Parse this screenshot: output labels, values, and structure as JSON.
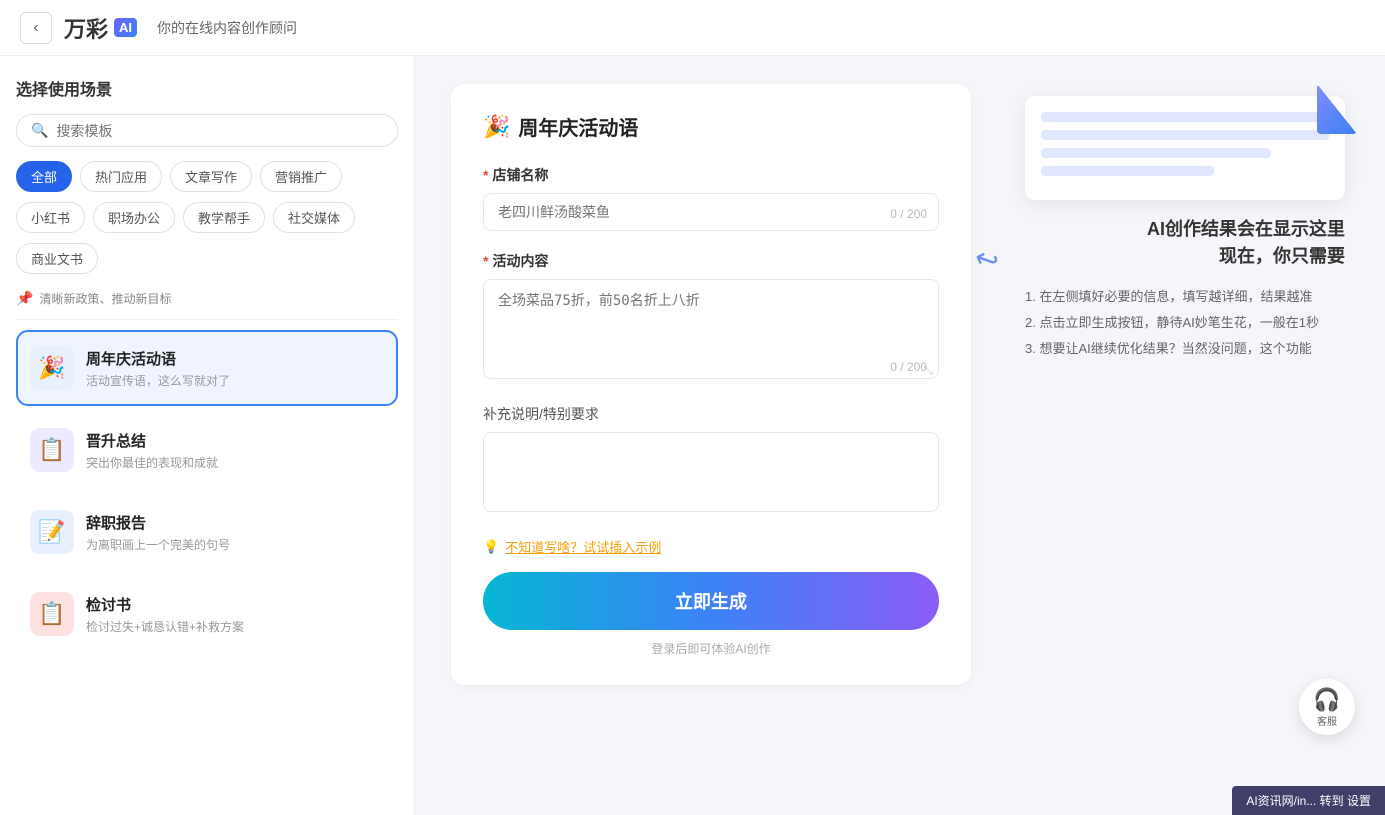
{
  "header": {
    "back_label": "‹",
    "logo_text": "万彩",
    "logo_ai": "AI",
    "subtitle": "你的在线内容创作顾问"
  },
  "sidebar": {
    "title": "选择使用场景",
    "search_placeholder": "搜索模板",
    "filter_tags": [
      {
        "label": "全部",
        "active": true
      },
      {
        "label": "热门应用",
        "active": false
      },
      {
        "label": "文章写作",
        "active": false
      },
      {
        "label": "营销推广",
        "active": false
      },
      {
        "label": "小红书",
        "active": false
      },
      {
        "label": "职场办公",
        "active": false
      },
      {
        "label": "教学帮手",
        "active": false
      },
      {
        "label": "社交媒体",
        "active": false
      },
      {
        "label": "商业文书",
        "active": false
      }
    ],
    "notice_text": "清晰新政策、推动新目标",
    "templates": [
      {
        "id": "anniversary",
        "icon": "🎉",
        "icon_class": "blue",
        "name": "周年庆活动语",
        "desc": "活动宣传语，这么写就对了",
        "active": true
      },
      {
        "id": "promotion",
        "icon": "📋",
        "icon_class": "purple",
        "name": "晋升总结",
        "desc": "突出你最佳的表现和成就",
        "active": false
      },
      {
        "id": "resignation",
        "icon": "📝",
        "icon_class": "blue",
        "name": "辞职报告",
        "desc": "为离职画上一个完美的句号",
        "active": false
      },
      {
        "id": "review",
        "icon": "📋",
        "icon_class": "red",
        "name": "检讨书",
        "desc": "检讨过失+诚恳认错+补救方案",
        "active": false
      }
    ]
  },
  "form": {
    "title": "周年庆活动语",
    "title_icon": "🎉",
    "fields": {
      "shop_name": {
        "label": "店铺名称",
        "required": true,
        "placeholder": "老四川鲜汤酸菜鱼",
        "char_count": "0 / 200"
      },
      "activity": {
        "label": "活动内容",
        "required": true,
        "placeholder": "全场菜品75折，前50名折上八折",
        "char_count": "0 / 200"
      },
      "supplement": {
        "label": "补充说明/特别要求",
        "required": false,
        "placeholder": ""
      }
    },
    "hint_text": "不知道写啥？试试插入示例",
    "hint_icon": "💡",
    "generate_btn": "立即生成",
    "login_hint": "登录后即可体验AI创作"
  },
  "illustration": {
    "caption_line1": "AI创作结果会在显示这里",
    "caption_line2": "现在，你只需要",
    "steps": [
      "1. 在左侧填好必要的信息，填写越详细，结果越准",
      "2. 点击立即生成按钮，静待AI妙笔生花，一般在1秒",
      "3. 想要让AI继续优化结果？当然没问题，这个功能"
    ]
  },
  "customer_service": {
    "label": "客服",
    "icon": "headset"
  },
  "bottom_bar": {
    "text": "AI资讯网/in... 转到 设置"
  }
}
